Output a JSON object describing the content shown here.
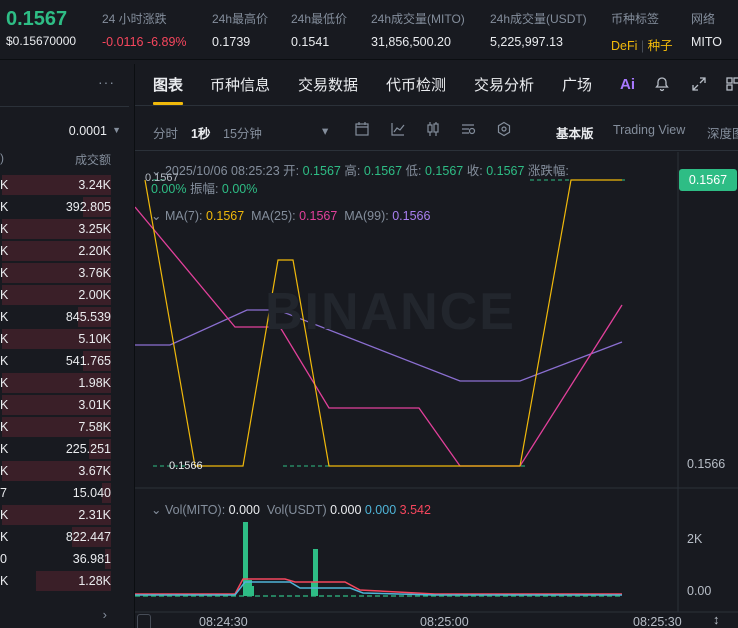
{
  "ticker": {
    "price": "0.1567",
    "usd_price": "$0.15670000",
    "change": {
      "label": "24 小时涨跌",
      "value": "-0.0116 -6.89%"
    },
    "high": {
      "label": "24h最高价",
      "value": "0.1739"
    },
    "low": {
      "label": "24h最低价",
      "value": "0.1541"
    },
    "vol_base": {
      "label": "24h成交量(MITO)",
      "value": "31,856,500.20"
    },
    "vol_quote": {
      "label": "24h成交量(USDT)",
      "value": "5,225,997.13"
    },
    "tags": {
      "label": "币种标签",
      "tag1": "DeFi",
      "tag2": "种子"
    },
    "network": {
      "label": "网络",
      "value": "MITO"
    }
  },
  "orderbook": {
    "more": "···",
    "precision": "0.0001",
    "header_left": ")",
    "header_right": "成交额",
    "rows": [
      {
        "l": "K",
        "r": "3.24K",
        "depth": 0.98
      },
      {
        "l": "K",
        "r": "392.805",
        "depth": 0.25
      },
      {
        "l": "K",
        "r": "3.25K",
        "depth": 0.98
      },
      {
        "l": "K",
        "r": "2.20K",
        "depth": 0.98
      },
      {
        "l": "K",
        "r": "3.76K",
        "depth": 0.98
      },
      {
        "l": "K",
        "r": "2.00K",
        "depth": 0.98
      },
      {
        "l": "K",
        "r": "845.539",
        "depth": 0.3
      },
      {
        "l": "K",
        "r": "5.10K",
        "depth": 0.98
      },
      {
        "l": "K",
        "r": "541.765",
        "depth": 0.25
      },
      {
        "l": "K",
        "r": "1.98K",
        "depth": 0.98
      },
      {
        "l": "K",
        "r": "3.01K",
        "depth": 0.98
      },
      {
        "l": "K",
        "r": "7.58K",
        "depth": 0.98
      },
      {
        "l": "K",
        "r": "225.251",
        "depth": 0.2
      },
      {
        "l": "K",
        "r": "3.67K",
        "depth": 0.98
      },
      {
        "l": "7",
        "r": "15.040",
        "depth": 0.08
      },
      {
        "l": "K",
        "r": "2.31K",
        "depth": 0.98
      },
      {
        "l": "K",
        "r": "822.447",
        "depth": 0.35
      },
      {
        "l": "0",
        "r": "36.981",
        "depth": 0.05
      },
      {
        "l": "K",
        "r": "1.28K",
        "depth": 0.68
      }
    ],
    "chevron": "›"
  },
  "tabs": [
    "图表",
    "币种信息",
    "交易数据",
    "代币检测",
    "交易分析",
    "广场"
  ],
  "tab_icons": {
    "ai": "Ai",
    "bell": "bell-icon",
    "expand": "expand-icon",
    "grid": "grid-icon"
  },
  "toolbar": {
    "time": "分时",
    "one_sec": "1秒",
    "fifteen_min": "15分钟",
    "caret": "▾",
    "basic": "基本版",
    "tradingview": "Trading View",
    "depth": "深度图"
  },
  "legend": {
    "date": "2025/10/06 08:25:23",
    "open_lbl": "开:",
    "open": "0.1567",
    "high_lbl": "高:",
    "high": "0.1567",
    "low_lbl": "低:",
    "low": "0.1567",
    "close_lbl": "收:",
    "close": "0.1567",
    "chg_lbl": "涨跌幅:",
    "chg": "0.00%",
    "amp_lbl": "振幅:",
    "amp": "0.00%",
    "ma7_lbl": "MA(7):",
    "ma7": "0.1567",
    "ma25_lbl": "MA(25):",
    "ma25": "0.1567",
    "ma99_lbl": "MA(99):",
    "ma99": "0.1566",
    "vol_lbl": "Vol(MITO):",
    "vol": "0.000",
    "volu_lbl": "Vol(USDT)",
    "volu": "0.000",
    "volu2": "0.000",
    "volu3": "3.542"
  },
  "chart_labels": {
    "watermark": "BINANCE",
    "price_tag": "0.1567",
    "axis_low": "0.1566",
    "top_left_price": "0.1567",
    "low_marker": "0.1566",
    "vol_axis_top": "2K",
    "vol_axis_bottom": "0.00",
    "times": [
      "08:24:30",
      "08:25:00",
      "08:25:30"
    ]
  },
  "colors": {
    "up": "#2ebd85",
    "down": "#f6465d",
    "ma7": "#f0b90b",
    "ma25": "#e2409b",
    "ma99": "#8b6fd1",
    "usdt": "#4fb4d8"
  }
}
